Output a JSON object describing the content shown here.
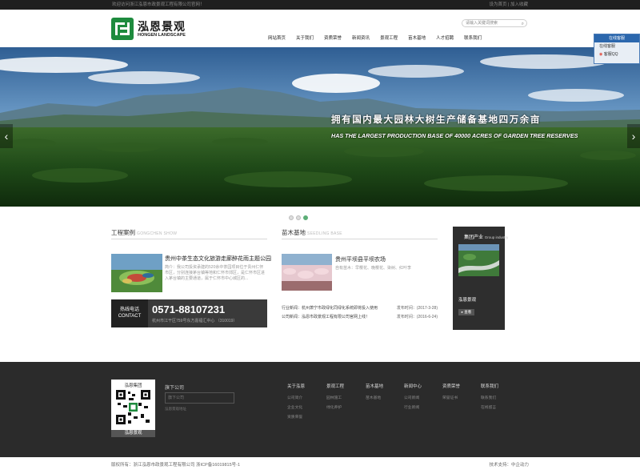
{
  "topbar": {
    "welcome": "欢迎访问浙江泓恩市政景观工程有限公司官网！",
    "links": "设为首页 | 加入收藏"
  },
  "logo": {
    "cn": "泓恩景观",
    "en": "HONGEN LANDSCAPE"
  },
  "search": {
    "placeholder": "请输入关键词搜索"
  },
  "nav": [
    "网站首页",
    "关于我们",
    "资质荣誉",
    "新闻资讯",
    "景观工程",
    "苗木基地",
    "人才招聘",
    "联系我们"
  ],
  "banner": {
    "slogan_cn": "拥有国内最大园林大树生产储备基地四万余亩",
    "slogan_en": "HAS THE LARGEST PRODUCTION BASE OF 40000 ACRES OF GARDEN TREE RESERVES",
    "prev": "‹",
    "next": "›",
    "active_dot": 3
  },
  "case": {
    "title": "工程案例",
    "title_en": "GONGCHEN SHOW",
    "item_title": "贵州中茶生态文化旅游走廊醉花雨主题公园",
    "item_desc": "简介：我公司投资承建的520余中茶园项目位于贵州仁怀市区，分别连接茅台镇等地和仁怀市郊区，是仁怀市区进入茅台镇的主要通道，属于仁怀市中心城区的..."
  },
  "hotline": {
    "label1": "热线电话",
    "label2": "CONTACT",
    "number": "0571-88107231",
    "address": "杭州市江干区759号东方嘉福汇中心 （310019）"
  },
  "seedling": {
    "title": "苗木基地",
    "title_en": "SEEDLING BASE",
    "item_title": "贵州平坝县平坝农场",
    "item_desc": "自有苗木：早樱花、晚樱花、柒树、红叶李"
  },
  "news": [
    {
      "text": "行业新闻：杭州萧宁市政绿化同绿化系统即将投入使用",
      "date": "发布时间：(2017-3-28)"
    },
    {
      "text": "公司新闻：泓恩市政景观工程有限公司官网上线！",
      "date": "发布时间：(2016-6-24)"
    }
  ],
  "group": {
    "title": "集团产业",
    "title_en": "Group industry",
    "name": "泓恩景观",
    "button": "▸ 查看"
  },
  "qq": {
    "header": "在线客服",
    "row1": "在线客服",
    "row2": "客服QQ"
  },
  "footer": {
    "qr_title": "泓恩集团",
    "qr_bottom": "泓恩景观",
    "sub_title": "旗下公司",
    "sub_input": "旗下公司",
    "sub_note": "泓恩景观地址",
    "columns": [
      {
        "head": "关于泓恩",
        "items": [
          "公司简介",
          "企业文化",
          "资质荣誉"
        ]
      },
      {
        "head": "景观工程",
        "items": [
          "园林施工",
          "绿化养护"
        ]
      },
      {
        "head": "苗木基地",
        "items": [
          "苗木基地"
        ]
      },
      {
        "head": "新闻中心",
        "items": [
          "公司新闻",
          "行业新闻"
        ]
      },
      {
        "head": "资质荣誉",
        "items": [
          "荣誉证书"
        ]
      },
      {
        "head": "联系我们",
        "items": [
          "联系我们",
          "在线留言"
        ]
      }
    ]
  },
  "bottom": {
    "copyright": "版权所有：浙江泓恩市政景观工程有限公司 浙ICP备16019815号-1",
    "support": "技术支持：中企动力"
  }
}
